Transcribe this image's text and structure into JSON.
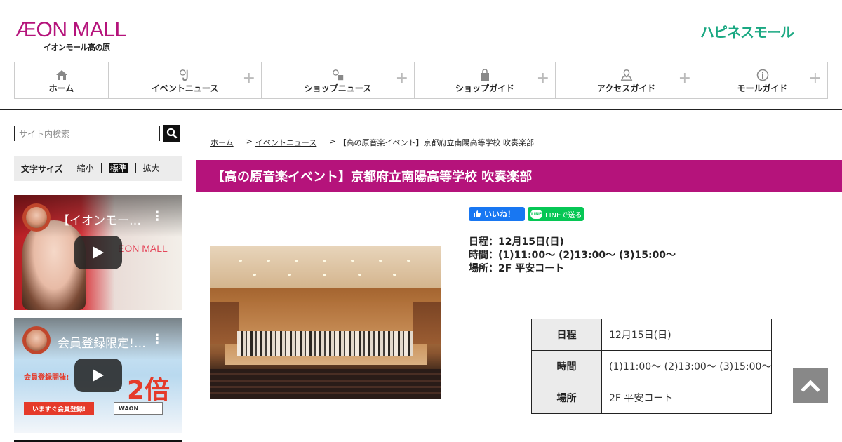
{
  "header": {
    "logo_main": "ÆON MALL",
    "logo_sub": "イオンモール高の原",
    "logo_right": "ハピネスモール"
  },
  "nav": [
    {
      "label": "ホーム",
      "icon": "home-icon",
      "has_plus": false
    },
    {
      "label": "イベントニュース",
      "icon": "saxophone-icon",
      "has_plus": true
    },
    {
      "label": "ショップニュース",
      "icon": "shopping-bag-info-icon",
      "has_plus": true
    },
    {
      "label": "ショップガイド",
      "icon": "bag-icon",
      "has_plus": true
    },
    {
      "label": "アクセスガイド",
      "icon": "map-pin-icon",
      "has_plus": true
    },
    {
      "label": "モールガイド",
      "icon": "info-icon",
      "has_plus": true
    }
  ],
  "sidebar": {
    "search_placeholder": "サイト内検索",
    "fontsize_title": "文字サイズ",
    "fontsize_options": [
      "縮小",
      "標準",
      "拡大"
    ],
    "fontsize_selected": "標準",
    "videos": [
      {
        "title": "【イオンモー…",
        "overlay": "EON MALL"
      },
      {
        "title": "会員登録限定!…",
        "promo_label": "会員登録開催!",
        "promo_big": "2倍",
        "promo_cta": "いますぐ会員登録!",
        "promo_waon": "WAON"
      }
    ]
  },
  "breadcrumb": {
    "home": "ホーム",
    "event": "イベントニュース",
    "current": "【高の原音楽イベント】京都府立南陽高等学校 吹奏楽部"
  },
  "article": {
    "title": "【高の原音楽イベント】京都府立南陽高等学校 吹奏楽部",
    "fb_label": "いいね！",
    "line_label": "LINEで送る",
    "info": [
      "日程：12月15日(日)",
      "時間：(1)11:00～ (2)13:00～ (3)15:00～",
      "場所：2F 平安コート"
    ],
    "table": [
      {
        "header": "日程",
        "value": "12月15日(日)"
      },
      {
        "header": "時間",
        "value": "(1)11:00～ (2)13:00～ (3)15:00～"
      },
      {
        "header": "場所",
        "value": "2F 平安コート"
      }
    ]
  },
  "colors": {
    "brand": "#b5137b",
    "happiness": "#1aa882",
    "facebook": "#1877f2",
    "line": "#06c755"
  }
}
